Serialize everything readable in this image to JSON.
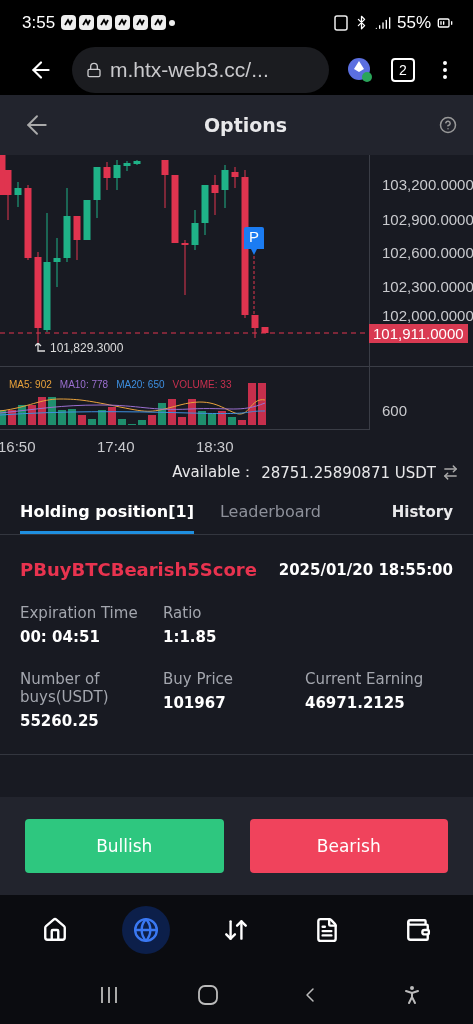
{
  "status_bar": {
    "time": "3:55",
    "battery": "55%"
  },
  "browser": {
    "url": "m.htx-web3.cc/...",
    "tab_count": "2"
  },
  "header": {
    "title": "Options"
  },
  "chart": {
    "price_ticks": [
      "103,200.0000",
      "102,900.0000",
      "102,600.0000",
      "102,300.0000",
      "102,000.0000"
    ],
    "current_price": "101,911.0000",
    "low_label": "101,829.3000",
    "marker": "P",
    "indicators": [
      {
        "label": "MA5: 902",
        "color": "#e9a23b"
      },
      {
        "label": "MA10: 778",
        "color": "#9b6fd0"
      },
      {
        "label": "MA20: 650",
        "color": "#3d8fe0"
      },
      {
        "label": "VOLUME: 33",
        "color": "#c9304f"
      }
    ],
    "volume_tick": "600",
    "time_ticks": [
      "16:50",
      "17:40",
      "18:30"
    ]
  },
  "available": {
    "label": "Available：",
    "value": "28751.25890871 USDT"
  },
  "tabs": [
    {
      "label": "Holding position[1]",
      "selected": true,
      "kind": "tab"
    },
    {
      "label": "Leaderboard",
      "selected": false,
      "kind": "tab"
    },
    {
      "label": "History",
      "selected": false,
      "kind": "link"
    }
  ],
  "position": {
    "name": "PBuyBTCBearish5Score",
    "time": "2025/01/20 18:55:00",
    "rows": [
      [
        {
          "label": "Expiration Time",
          "value": "00: 04:51"
        },
        {
          "label": "Ratio",
          "value": "1:1.85"
        }
      ],
      [
        {
          "label": "Number of buys(USDT)",
          "value": "55260.25"
        },
        {
          "label": "Buy Price",
          "value": "101967"
        },
        {
          "label": "Current Earning",
          "value": "46971.2125"
        }
      ]
    ]
  },
  "actions": [
    {
      "label": "Bullish",
      "kind": "bullish"
    },
    {
      "label": "Bearish",
      "kind": "bearish"
    }
  ],
  "bottom_nav": [
    {
      "selected": false
    },
    {
      "selected": true
    },
    {
      "selected": false
    },
    {
      "selected": false
    },
    {
      "selected": false
    }
  ]
}
